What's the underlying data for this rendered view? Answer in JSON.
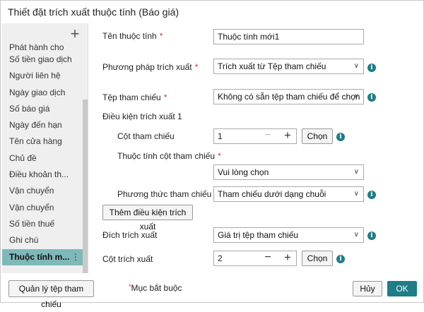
{
  "dialog": {
    "title": "Thiết đặt trích xuất thuộc tính (Báo giá)"
  },
  "sidebar": {
    "add_icon": "plus-icon",
    "items": [
      {
        "label": "Phát hành cho"
      },
      {
        "label": "Số tiền giao dịch"
      },
      {
        "label": "Người liên hệ"
      },
      {
        "label": "Ngày giao dịch"
      },
      {
        "label": "Số báo giá"
      },
      {
        "label": "Ngày đến hạn"
      },
      {
        "label": "Tên cửa hàng"
      },
      {
        "label": "Chủ đề"
      },
      {
        "label": "Điều khoản th..."
      },
      {
        "label": "Vận chuyển"
      },
      {
        "label": "Vận chuyển"
      },
      {
        "label": "Số tiền thuế"
      },
      {
        "label": "Ghi chú"
      },
      {
        "label": "Thuộc tính m...",
        "active": true
      }
    ],
    "kebab": "⋮"
  },
  "form": {
    "attr_name": {
      "label": "Tên thuộc tính",
      "required": "*",
      "value": "Thuộc tính mới1"
    },
    "method": {
      "label": "Phương pháp trích xuất",
      "required": "*",
      "value": "Trích xuất từ Tệp tham chiếu"
    },
    "ref_file": {
      "label": "Tệp tham chiếu",
      "required": "*",
      "value": "Không có sẵn tệp tham chiếu để chọn"
    },
    "condition_heading": "Điều kiện trích xuất 1",
    "ref_column": {
      "label": "Cột tham chiếu",
      "value": "1",
      "choose": "Chọn"
    },
    "ref_column_attr": {
      "label": "Thuộc tính cột tham chiếu",
      "required": "*",
      "value": "Vui lòng chọn"
    },
    "ref_mode": {
      "label": "Phương thức tham chiếu",
      "value": "Tham chiếu dưới dạng chuỗi"
    },
    "add_condition": "Thêm điều kiện trích xuất",
    "target": {
      "label": "Đích trích xuất",
      "value": "Giá trị tệp tham chiếu"
    },
    "extract_column": {
      "label": "Cột trích xuất",
      "value": "2",
      "choose": "Chọn"
    }
  },
  "footer": {
    "manage_ref": "Quản lý tệp tham chiếu",
    "required_star": "*",
    "required_note": "Mục bắt buộc",
    "cancel": "Hủy",
    "ok": "OK"
  },
  "colors": {
    "accent": "#1e7d86",
    "active_item": "#7fb8b8",
    "required": "#dd3333"
  }
}
